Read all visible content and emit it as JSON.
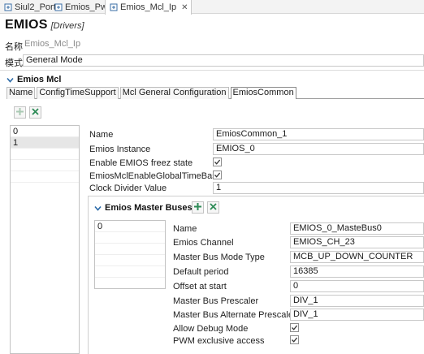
{
  "editor_tabs": [
    {
      "label": "Siul2_Port",
      "icon": "config-file-icon",
      "active": false
    },
    {
      "label": "Emios_Pwm",
      "icon": "config-file-icon",
      "active": false
    },
    {
      "label": "Emios_Mcl_Ip",
      "icon": "config-file-icon",
      "active": true,
      "close": "✕"
    }
  ],
  "title": {
    "main": "EMIOS",
    "sub": "[Drivers]"
  },
  "name_row": {
    "label": "名称",
    "value": "Emios_Mcl_Ip"
  },
  "mode_row": {
    "label": "模式",
    "value": "General Mode"
  },
  "section": {
    "title": "Emios Mcl"
  },
  "form_tabs": [
    "Name",
    "ConfigTimeSupport",
    "Mcl General Configuration",
    "EmiosCommon"
  ],
  "active_form_tab": "EmiosCommon",
  "common_list": {
    "items": [
      "0",
      "1"
    ],
    "selected": "1"
  },
  "common_fields": {
    "name_label": "Name",
    "name_value": "EmiosCommon_1",
    "instance_label": "Emios Instance",
    "instance_value": "EMIOS_0",
    "freeze_label": "Enable EMIOS freez state",
    "freeze_checked": true,
    "globaltb_label": "EmiosMclEnableGlobalTimeBase",
    "globaltb_checked": true,
    "divider_label": "Clock Divider Value",
    "divider_value": "1"
  },
  "master_buses": {
    "title": "Emios Master Buses",
    "list": {
      "items": [
        "0"
      ],
      "selected": "0"
    },
    "name_label": "Name",
    "name_value": "EMIOS_0_MasteBus0",
    "channel_label": "Emios Channel",
    "channel_value": "EMIOS_CH_23",
    "mode_label": "Master Bus Mode Type",
    "mode_value": "MCB_UP_DOWN_COUNTER",
    "period_label": "Default period",
    "period_value": "16385",
    "offset_label": "Offset at start",
    "offset_value": "0",
    "prescaler_label": "Master Bus Prescaler",
    "prescaler_value": "DIV_1",
    "alt_prescaler_label": "Master Bus Alternate Prescaler",
    "alt_prescaler_value": "DIV_1",
    "debug_label": "Allow Debug Mode",
    "debug_checked": true,
    "pwm_label": "PWM exclusive access",
    "pwm_checked": true
  },
  "colors": {
    "add_icon": "#2e8b57",
    "remove_icon": "#2e8b57",
    "check": "#333333"
  }
}
